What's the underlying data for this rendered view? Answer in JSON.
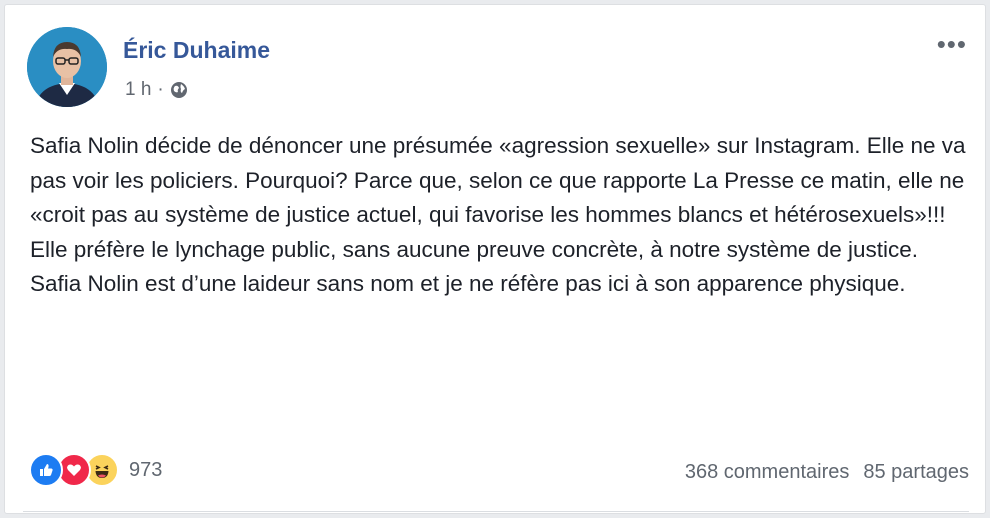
{
  "post": {
    "author": {
      "name": "Éric Duhaime",
      "avatar_icon": "profile-photo"
    },
    "timestamp": "1 h",
    "separator": "·",
    "audience_icon": "globe-icon",
    "more_label": "•••",
    "body": [
      "Safia Nolin décide de dénoncer une présumée «agression sexuelle» sur Instagram. Elle ne va pas voir les policiers. Pourquoi? Parce que, selon ce que rapporte La Presse ce matin, elle ne «croit pas au système de justice actuel, qui favorise les hommes blancs et hétérosexuels»!!!",
      "Elle préfère le lynchage public, sans aucune preuve concrète, à notre système de justice.",
      "Safia Nolin est d’une laideur sans nom et je ne réfère pas ici à son apparence physique."
    ]
  },
  "engagement": {
    "reaction_icons": [
      "like-icon",
      "love-icon",
      "haha-icon"
    ],
    "reaction_count": "973",
    "comments": "368 commentaires",
    "shares": "85 partages"
  },
  "colors": {
    "author_link": "#365899",
    "text": "#1d2129",
    "secondary": "#606770",
    "like": "#1d7cf2",
    "love": "#f0284a",
    "haha": "#fbd35c"
  }
}
